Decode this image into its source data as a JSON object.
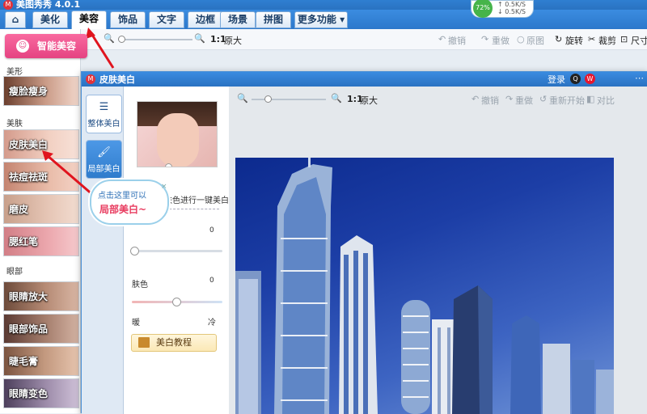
{
  "app": {
    "title": "美图秀秀 4.0.1"
  },
  "tabs": [
    {
      "label": "⌂"
    },
    {
      "label": "美化"
    },
    {
      "label": "美容"
    },
    {
      "label": "饰品"
    },
    {
      "label": "文字"
    },
    {
      "label": "边框"
    },
    {
      "label": "场景"
    },
    {
      "label": "拼图"
    },
    {
      "label": "更多功能 ▾"
    }
  ],
  "net": {
    "percent": "72%",
    "up": "↑ 0.5K/S",
    "down": "↓ 0.5K/S"
  },
  "toolbar": {
    "zoom_ratio": "1:1",
    "original_size": "原大",
    "undo": "撤销",
    "redo": "重做",
    "original": "原图",
    "rotate": "旋转",
    "crop": "裁剪",
    "size": "尺寸"
  },
  "sidebar": {
    "smart_button": "智能美容",
    "sections": {
      "shape": "美形",
      "skin": "美肤",
      "eyes": "眼部"
    },
    "items": [
      "瘦脸瘦身",
      "皮肤美白",
      "祛痘祛斑",
      "磨皮",
      "腮红笔",
      "眼睛放大",
      "眼部饰品",
      "睫毛膏",
      "眼睛变色"
    ]
  },
  "dialog": {
    "title": "皮肤美白",
    "login": "登录",
    "more": "",
    "tabs": [
      "整体美白",
      "局部美白"
    ],
    "description": "对人物肤色进行一键美白",
    "strength_value": "0",
    "skin_label": "肤色",
    "skin_value": "0",
    "warm_label": "暖",
    "cool_label": "冷",
    "tutorial": "美白教程",
    "preview": {
      "zoom_ratio": "1:1",
      "original_size": "原大",
      "undo": "撤销",
      "redo": "重做",
      "restart": "重新开始",
      "compare": "对比"
    }
  },
  "callout": {
    "line1": "点击这里可以",
    "line2": "局部美白~",
    "close": "×"
  },
  "colors": {
    "tab_blue": "#2c78cb",
    "pink_button": "#e54382",
    "arrow_red": "#e0141e"
  }
}
